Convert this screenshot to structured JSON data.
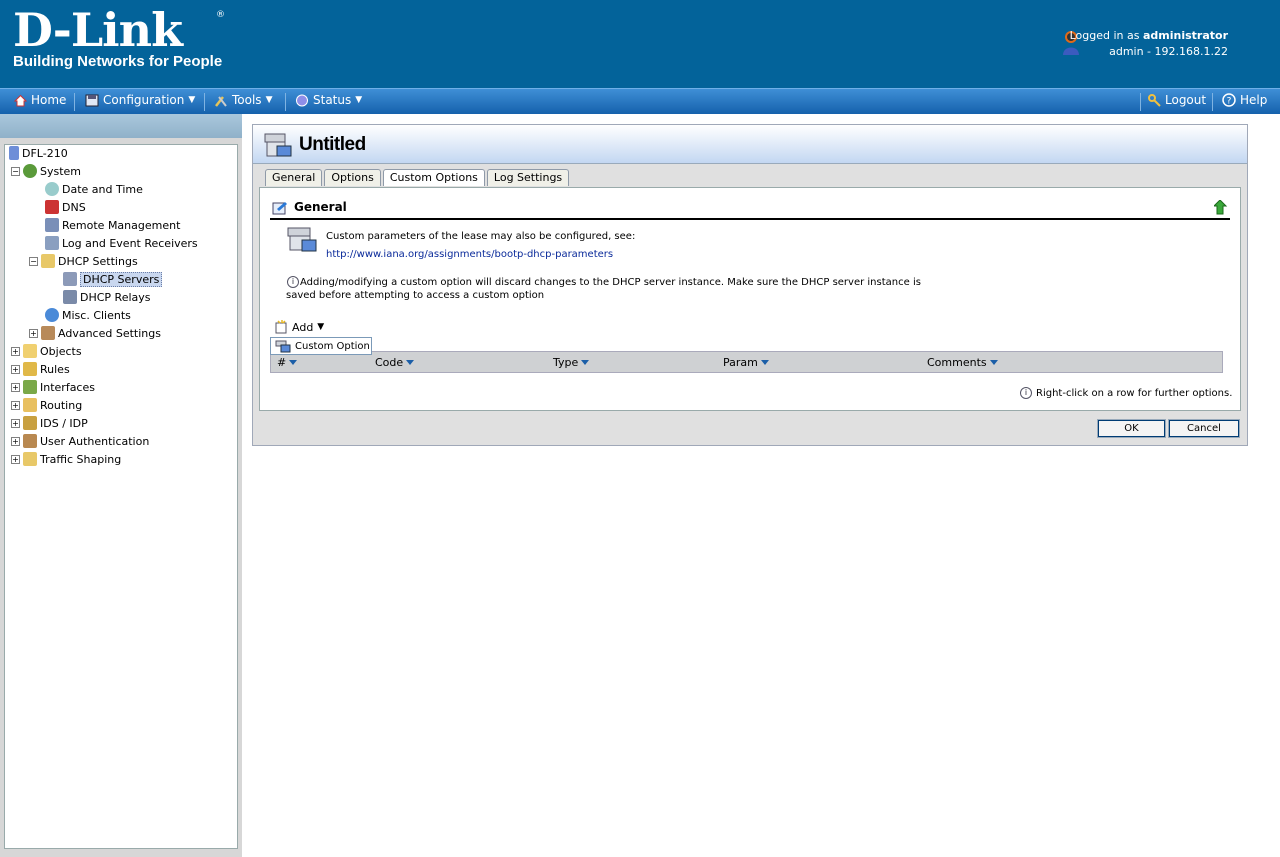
{
  "header": {
    "logo_brand": "D-Link",
    "logo_tagline": "Building Networks for People",
    "logged_in_prefix": "Logged in as",
    "logged_in_user": "administrator",
    "session": "admin - 192.168.1.22"
  },
  "menu": {
    "home": "Home",
    "configuration": "Configuration",
    "tools": "Tools",
    "status": "Status",
    "logout": "Logout",
    "help": "Help"
  },
  "tree": {
    "root": "DFL-210",
    "system": "System",
    "date_time": "Date and Time",
    "dns": "DNS",
    "remote_mgmt": "Remote Management",
    "log_event": "Log and Event Receivers",
    "dhcp_settings": "DHCP Settings",
    "dhcp_servers": "DHCP Servers",
    "dhcp_relays": "DHCP Relays",
    "misc_clients": "Misc. Clients",
    "advanced_settings": "Advanced Settings",
    "objects": "Objects",
    "rules": "Rules",
    "interfaces": "Interfaces",
    "routing": "Routing",
    "ids_idp": "IDS / IDP",
    "user_auth": "User Authentication",
    "traffic_shaping": "Traffic Shaping"
  },
  "page": {
    "title": "Untitled",
    "tabs": [
      "General",
      "Options",
      "Custom Options",
      "Log Settings"
    ],
    "section_title": "General",
    "desc_line": "Custom parameters of the lease may also be configured, see:",
    "desc_link": "http://www.iana.org/assignments/bootp-dhcp-parameters",
    "warning_line1": "Adding/modifying a custom option will discard changes to the DHCP server instance. Make sure the DHCP server instance is",
    "warning_line2": "saved before attempting to access a custom option",
    "add_label": "Add",
    "popup_item": "Custom Option",
    "columns": [
      "#",
      "Code",
      "Type",
      "Param",
      "Comments"
    ],
    "hint": "Right-click on a row for further options.",
    "ok": "OK",
    "cancel": "Cancel"
  },
  "colors": {
    "header_bg": "#03639a",
    "menubar": "#1561ac",
    "title_gradient_end": "#c3d7f2"
  }
}
